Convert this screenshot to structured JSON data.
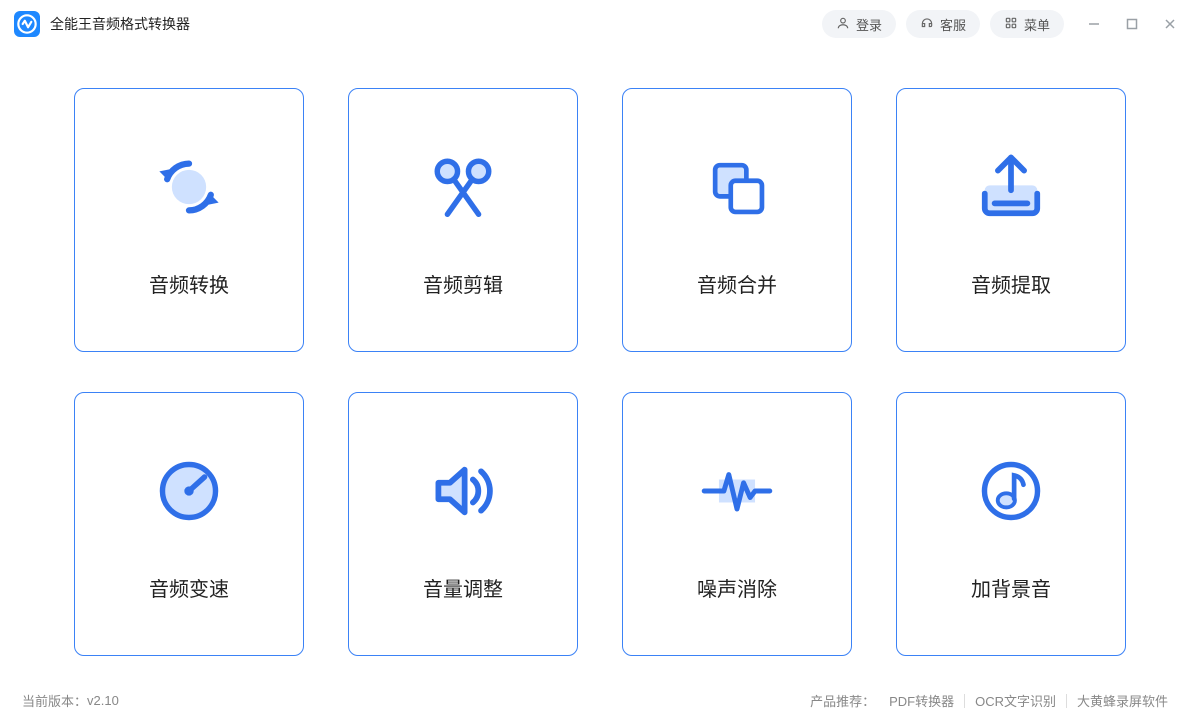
{
  "app": {
    "title": "全能王音频格式转换器"
  },
  "titlebar": {
    "login": "登录",
    "support": "客服",
    "menu": "菜单"
  },
  "features": [
    {
      "id": "convert",
      "label": "音频转换"
    },
    {
      "id": "trim",
      "label": "音频剪辑"
    },
    {
      "id": "merge",
      "label": "音频合并"
    },
    {
      "id": "extract",
      "label": "音频提取"
    },
    {
      "id": "speed",
      "label": "音频变速"
    },
    {
      "id": "volume",
      "label": "音量调整"
    },
    {
      "id": "denoise",
      "label": "噪声消除"
    },
    {
      "id": "bgm",
      "label": "加背景音"
    }
  ],
  "footer": {
    "version_label": "当前版本：",
    "version_value": "v2.10",
    "reco_label": "产品推荐：",
    "links": [
      "PDF转换器",
      "OCR文字识别",
      "大黄蜂录屏软件"
    ]
  },
  "colors": {
    "accent": "#3b82f6",
    "accent_fill": "#cfe1ff"
  }
}
